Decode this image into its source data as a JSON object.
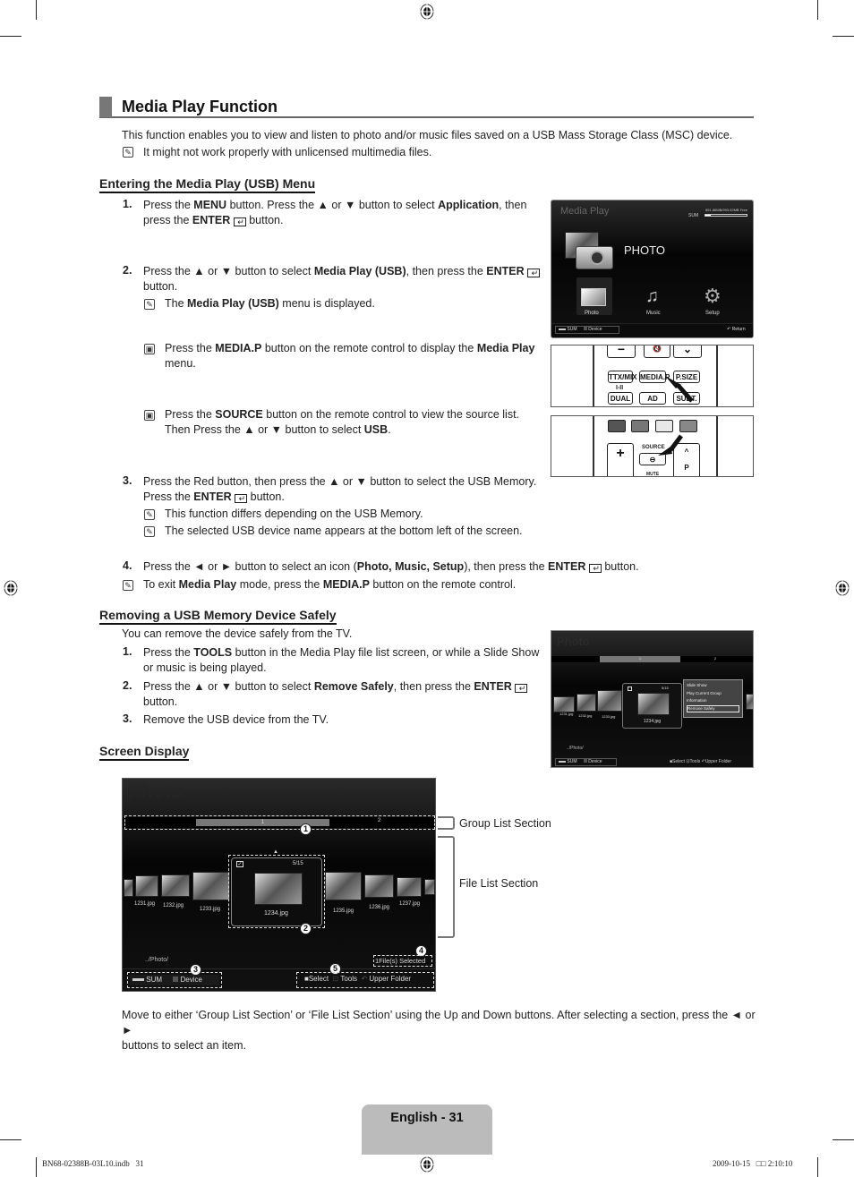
{
  "page": {
    "title": "Media Play Function",
    "intro": "This function enables you to view and listen to photo and/or music files saved on a USB Mass Storage Class (MSC) device.",
    "intro_note": "It might not work properly with unlicensed multimedia files."
  },
  "entering": {
    "heading": "Entering the Media Play (USB) Menu",
    "step1": {
      "num": "1.",
      "a": "Press the ",
      "b1": "MENU",
      "c": " button. Press the ▲ or ▼ button to select ",
      "b2": "Application",
      "d": ", then",
      "line2a": "press the ",
      "b3": "ENTER",
      "line2b": " button."
    },
    "step2": {
      "num": "2.",
      "a": "Press the ▲ or ▼ button to select ",
      "b1": "Media Play (USB)",
      "c": ", then press the ",
      "b2": "ENTER",
      "line2": "button.",
      "note_a": "The ",
      "note_b": "Media Play (USB)",
      "note_c": " menu is displayed."
    },
    "remote_note1": {
      "a": "Press the ",
      "b1": "MEDIA.P",
      "c": " button on the remote control to display the ",
      "b2": "Media Play",
      "line2": "menu."
    },
    "remote_note2": {
      "a": "Press the ",
      "b1": "SOURCE",
      "c": " button on the remote control to view the source list.",
      "line2a": "Then Press the ▲ or ▼ button to select ",
      "b2": "USB",
      "line2b": "."
    },
    "step3": {
      "num": "3.",
      "line1": "Press the Red button, then press the ▲ or ▼ button to select the USB Memory.",
      "line2a": "Press the ",
      "b1": "ENTER",
      "line2b": " button.",
      "note1": "This function differs depending on the USB Memory.",
      "note2": "The selected USB device name appears at the bottom left of the screen."
    },
    "step4": {
      "num": "4.",
      "a": "Press the ◄ or ► button to select an icon (",
      "b1": "Photo, Music, Setup",
      "c": "), then press the ",
      "b2": "ENTER",
      "d": " button."
    },
    "step4_note": {
      "a": "To exit ",
      "b1": "Media Play",
      "c": " mode, press the ",
      "b2": "MEDIA.P",
      "d": " button on the remote control."
    }
  },
  "removing": {
    "heading": "Removing a USB Memory Device Safely",
    "intro": "You can remove the device safely from the TV.",
    "step1": {
      "num": "1.",
      "a": "Press the ",
      "b1": "TOOLS",
      "c": " button in the Media Play file list screen, or while a Slide Show",
      "line2": "or music is being played."
    },
    "step2": {
      "num": "2.",
      "a": "Press the ▲ or ▼ button to select ",
      "b1": "Remove Safely",
      "c": ", then press the ",
      "b2": "ENTER",
      "line2": "button."
    },
    "step3": {
      "num": "3.",
      "text": "Remove the USB device from the TV."
    }
  },
  "screen_display": {
    "heading": "Screen Display",
    "group_label": "Group List Section",
    "file_label": "File List Section",
    "description_line1": "Move to either ‘Group List Section’ or ‘File List Section’ using the Up and Down buttons. After selecting a section, press the ◄ or ►",
    "description_line2": "buttons to select an item."
  },
  "media_play_screen": {
    "title": "Media Play",
    "device": "SUM",
    "storage": "851.86MB/993.02MB Free",
    "storage_used_fraction": 0.14,
    "current": "PHOTO",
    "icons": [
      {
        "label": "Photo",
        "icon": "photo-icon"
      },
      {
        "label": "Music",
        "icon": "music-note-icon"
      },
      {
        "label": "Setup",
        "icon": "gear-icon"
      }
    ],
    "bottom_left": [
      "SUM",
      "Device"
    ],
    "bottom_right": "Return"
  },
  "remote1": {
    "buttons": [
      "TTX/MIX",
      "MEDIA.P",
      "P.SIZE",
      "DUAL",
      "AD",
      "SUBT."
    ],
    "label_i_ii": "I-II"
  },
  "remote2": {
    "buttons": [
      "SOURCE",
      "P",
      "MUTE"
    ]
  },
  "tools_screen": {
    "title": "Photo",
    "group_1": "1",
    "group_2": "2",
    "counter": "5/15",
    "selected_file": "1234.jpg",
    "files_left": [
      "1231.jpg",
      "1232.jpg",
      "1233.jpg"
    ],
    "menu": [
      "Slide Show",
      "Play Current Group",
      "Information",
      "Remove Safely"
    ],
    "path": "../Photo/",
    "bottom_left": [
      "SUM",
      "Device"
    ],
    "bottom_right": [
      "Select",
      "Tools",
      "Upper Folder"
    ]
  },
  "photo_screen": {
    "title": "Photo",
    "group_1": "1",
    "group_2": "2",
    "counter": "5/15",
    "selected_file": "1234.jpg",
    "files": [
      "1231.jpg",
      "1232.jpg",
      "1233.jpg",
      "1235.jpg",
      "1236.jpg",
      "1237.jpg"
    ],
    "path": "../Photo/",
    "selected_count": "1File(s) Selected",
    "bottom_left": [
      "SUM",
      "Device"
    ],
    "bottom_right": [
      "Select",
      "Tools",
      "Upper Folder"
    ],
    "callouts": [
      "1",
      "2",
      "3",
      "4",
      "5"
    ]
  },
  "footer": {
    "page_label": "English - 31",
    "file": "BN68-02388B-03L10.indb   31",
    "timestamp": "2009-10-15   □□ 2:10:10"
  }
}
